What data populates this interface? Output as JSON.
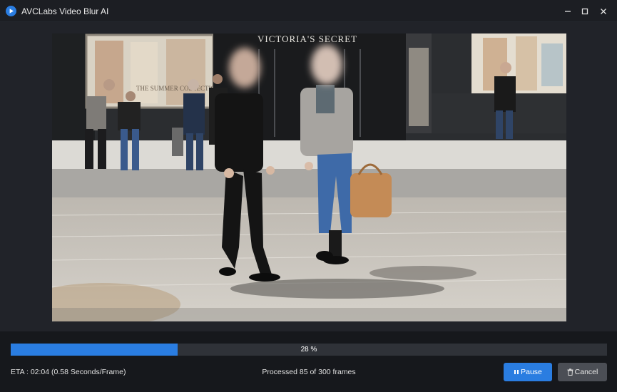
{
  "window": {
    "title": "AVCLabs Video Blur AI",
    "icon": "app-logo-icon"
  },
  "preview": {
    "storefront_sign": "VICTORIA'S SECRET",
    "poster_text": "THE SUMMER COLLECTION"
  },
  "progress": {
    "fraction": 0.28,
    "label": "28 %",
    "color": "#2a7de1"
  },
  "status": {
    "eta": "ETA : 02:04 (0.58 Seconds/Frame)",
    "frames": "Processed 85 of 300 frames"
  },
  "actions": {
    "pause_label": "Pause",
    "pause_icon": "pause-icon",
    "cancel_label": "Cancel",
    "cancel_icon": "trash-icon"
  }
}
